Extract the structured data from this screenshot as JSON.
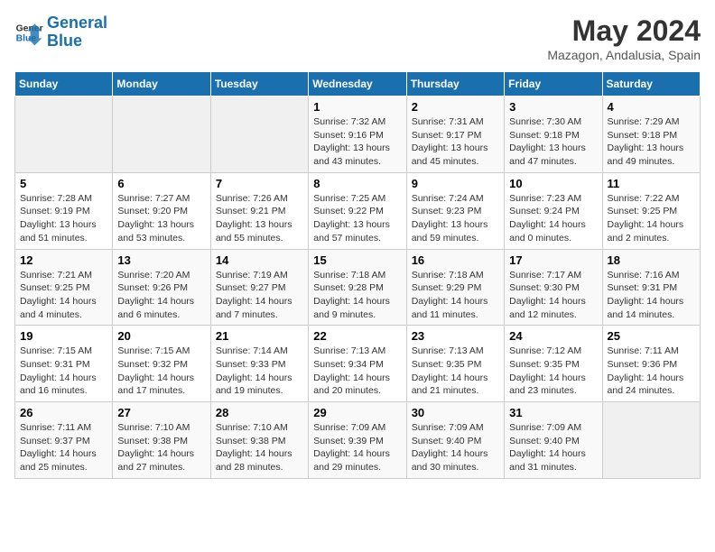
{
  "header": {
    "logo_line1": "General",
    "logo_line2": "Blue",
    "title": "May 2024",
    "subtitle": "Mazagon, Andalusia, Spain"
  },
  "weekdays": [
    "Sunday",
    "Monday",
    "Tuesday",
    "Wednesday",
    "Thursday",
    "Friday",
    "Saturday"
  ],
  "weeks": [
    [
      {
        "day": "",
        "info": ""
      },
      {
        "day": "",
        "info": ""
      },
      {
        "day": "",
        "info": ""
      },
      {
        "day": "1",
        "info": "Sunrise: 7:32 AM\nSunset: 9:16 PM\nDaylight: 13 hours and 43 minutes."
      },
      {
        "day": "2",
        "info": "Sunrise: 7:31 AM\nSunset: 9:17 PM\nDaylight: 13 hours and 45 minutes."
      },
      {
        "day": "3",
        "info": "Sunrise: 7:30 AM\nSunset: 9:18 PM\nDaylight: 13 hours and 47 minutes."
      },
      {
        "day": "4",
        "info": "Sunrise: 7:29 AM\nSunset: 9:18 PM\nDaylight: 13 hours and 49 minutes."
      }
    ],
    [
      {
        "day": "5",
        "info": "Sunrise: 7:28 AM\nSunset: 9:19 PM\nDaylight: 13 hours and 51 minutes."
      },
      {
        "day": "6",
        "info": "Sunrise: 7:27 AM\nSunset: 9:20 PM\nDaylight: 13 hours and 53 minutes."
      },
      {
        "day": "7",
        "info": "Sunrise: 7:26 AM\nSunset: 9:21 PM\nDaylight: 13 hours and 55 minutes."
      },
      {
        "day": "8",
        "info": "Sunrise: 7:25 AM\nSunset: 9:22 PM\nDaylight: 13 hours and 57 minutes."
      },
      {
        "day": "9",
        "info": "Sunrise: 7:24 AM\nSunset: 9:23 PM\nDaylight: 13 hours and 59 minutes."
      },
      {
        "day": "10",
        "info": "Sunrise: 7:23 AM\nSunset: 9:24 PM\nDaylight: 14 hours and 0 minutes."
      },
      {
        "day": "11",
        "info": "Sunrise: 7:22 AM\nSunset: 9:25 PM\nDaylight: 14 hours and 2 minutes."
      }
    ],
    [
      {
        "day": "12",
        "info": "Sunrise: 7:21 AM\nSunset: 9:25 PM\nDaylight: 14 hours and 4 minutes."
      },
      {
        "day": "13",
        "info": "Sunrise: 7:20 AM\nSunset: 9:26 PM\nDaylight: 14 hours and 6 minutes."
      },
      {
        "day": "14",
        "info": "Sunrise: 7:19 AM\nSunset: 9:27 PM\nDaylight: 14 hours and 7 minutes."
      },
      {
        "day": "15",
        "info": "Sunrise: 7:18 AM\nSunset: 9:28 PM\nDaylight: 14 hours and 9 minutes."
      },
      {
        "day": "16",
        "info": "Sunrise: 7:18 AM\nSunset: 9:29 PM\nDaylight: 14 hours and 11 minutes."
      },
      {
        "day": "17",
        "info": "Sunrise: 7:17 AM\nSunset: 9:30 PM\nDaylight: 14 hours and 12 minutes."
      },
      {
        "day": "18",
        "info": "Sunrise: 7:16 AM\nSunset: 9:31 PM\nDaylight: 14 hours and 14 minutes."
      }
    ],
    [
      {
        "day": "19",
        "info": "Sunrise: 7:15 AM\nSunset: 9:31 PM\nDaylight: 14 hours and 16 minutes."
      },
      {
        "day": "20",
        "info": "Sunrise: 7:15 AM\nSunset: 9:32 PM\nDaylight: 14 hours and 17 minutes."
      },
      {
        "day": "21",
        "info": "Sunrise: 7:14 AM\nSunset: 9:33 PM\nDaylight: 14 hours and 19 minutes."
      },
      {
        "day": "22",
        "info": "Sunrise: 7:13 AM\nSunset: 9:34 PM\nDaylight: 14 hours and 20 minutes."
      },
      {
        "day": "23",
        "info": "Sunrise: 7:13 AM\nSunset: 9:35 PM\nDaylight: 14 hours and 21 minutes."
      },
      {
        "day": "24",
        "info": "Sunrise: 7:12 AM\nSunset: 9:35 PM\nDaylight: 14 hours and 23 minutes."
      },
      {
        "day": "25",
        "info": "Sunrise: 7:11 AM\nSunset: 9:36 PM\nDaylight: 14 hours and 24 minutes."
      }
    ],
    [
      {
        "day": "26",
        "info": "Sunrise: 7:11 AM\nSunset: 9:37 PM\nDaylight: 14 hours and 25 minutes."
      },
      {
        "day": "27",
        "info": "Sunrise: 7:10 AM\nSunset: 9:38 PM\nDaylight: 14 hours and 27 minutes."
      },
      {
        "day": "28",
        "info": "Sunrise: 7:10 AM\nSunset: 9:38 PM\nDaylight: 14 hours and 28 minutes."
      },
      {
        "day": "29",
        "info": "Sunrise: 7:09 AM\nSunset: 9:39 PM\nDaylight: 14 hours and 29 minutes."
      },
      {
        "day": "30",
        "info": "Sunrise: 7:09 AM\nSunset: 9:40 PM\nDaylight: 14 hours and 30 minutes."
      },
      {
        "day": "31",
        "info": "Sunrise: 7:09 AM\nSunset: 9:40 PM\nDaylight: 14 hours and 31 minutes."
      },
      {
        "day": "",
        "info": ""
      }
    ]
  ]
}
